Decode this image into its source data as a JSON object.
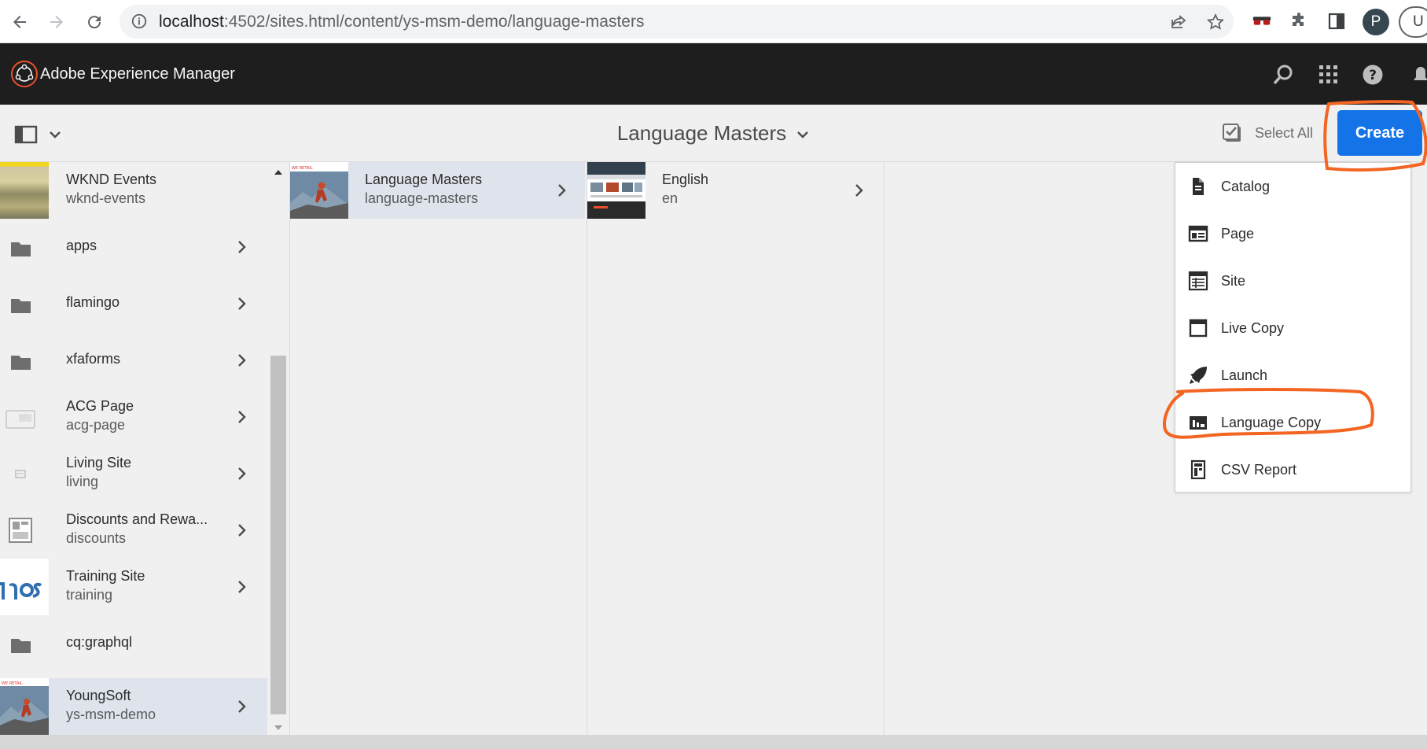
{
  "browser": {
    "url_host": "localhost",
    "url_rest": ":4502/sites.html/content/ys-msm-demo/language-masters",
    "profile_initial": "P",
    "profile2_initial": "U"
  },
  "shell": {
    "title": "Adobe Experience Manager"
  },
  "actionbar": {
    "title": "Language Masters",
    "select_all": "Select All",
    "create": "Create"
  },
  "column1": {
    "items": [
      {
        "title": "WKND Events",
        "subtitle": "wknd-events",
        "thumb": "photo-field"
      },
      {
        "title": "apps",
        "subtitle": "",
        "thumb": "folder-icon"
      },
      {
        "title": "flamingo",
        "subtitle": "",
        "thumb": "folder-icon"
      },
      {
        "title": "xfaforms",
        "subtitle": "",
        "thumb": "folder-icon"
      },
      {
        "title": "ACG Page",
        "subtitle": "acg-page",
        "thumb": "page-icon"
      },
      {
        "title": "Living Site",
        "subtitle": "living",
        "thumb": "small-page-icon"
      },
      {
        "title": "Discounts and Rewa...",
        "subtitle": "discounts",
        "thumb": "template-icon"
      },
      {
        "title": "Training Site",
        "subtitle": "training",
        "thumb": "text-logo"
      },
      {
        "title": "cq:graphql",
        "subtitle": "",
        "thumb": "folder-icon"
      },
      {
        "title": "YoungSoft",
        "subtitle": "ys-msm-demo",
        "thumb": "photo-climber"
      }
    ],
    "selected_index": 9
  },
  "column2": {
    "items": [
      {
        "title": "Language Masters",
        "subtitle": "language-masters",
        "thumb": "photo-climber"
      }
    ]
  },
  "column3": {
    "items": [
      {
        "title": "English",
        "subtitle": "en",
        "thumb": "site-screenshot"
      }
    ]
  },
  "create_menu": {
    "items": [
      {
        "label": "Catalog",
        "icon": "catalog-icon"
      },
      {
        "label": "Page",
        "icon": "page-icon"
      },
      {
        "label": "Site",
        "icon": "site-icon"
      },
      {
        "label": "Live Copy",
        "icon": "live-copy-icon"
      },
      {
        "label": "Launch",
        "icon": "launch-icon"
      },
      {
        "label": "Language Copy",
        "icon": "language-copy-icon"
      },
      {
        "label": "CSV Report",
        "icon": "csv-report-icon"
      }
    ]
  },
  "colors": {
    "shell": "#1e1e1e",
    "accent": "#1473e6",
    "annotation": "#f26522",
    "selected_row": "#dfe3ec"
  }
}
